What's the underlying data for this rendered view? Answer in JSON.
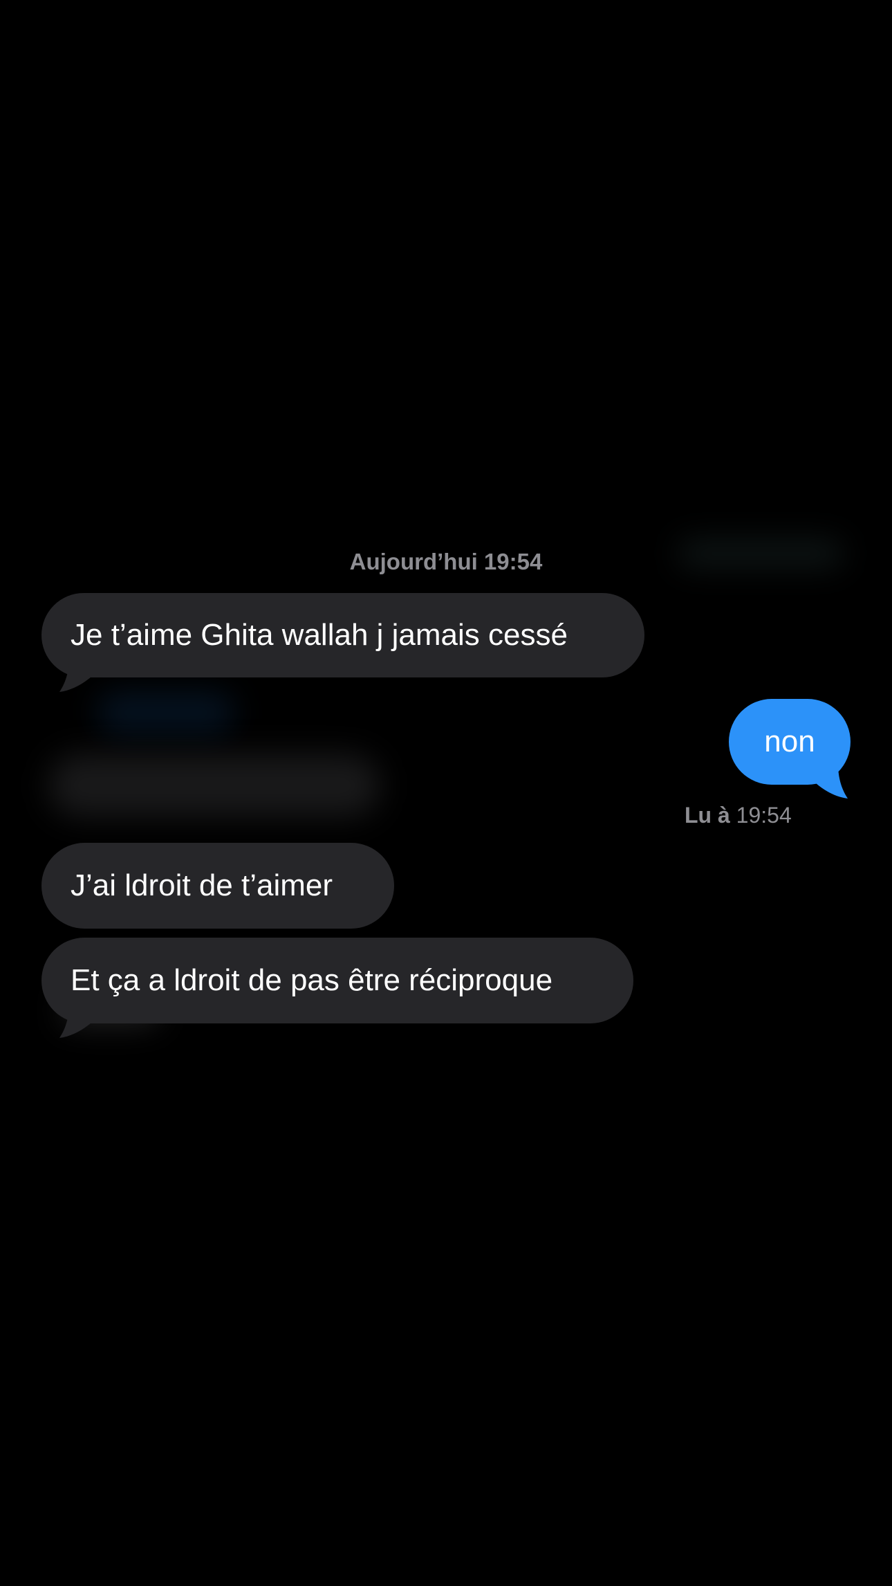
{
  "conversation": {
    "timestamp": "Aujourd’hui 19:54",
    "messages": [
      {
        "direction": "incoming",
        "text": "Je t’aime Ghita wallah j jamais cessé"
      },
      {
        "direction": "outgoing",
        "text": "non"
      },
      {
        "direction": "incoming",
        "text": "J’ai ldroit de t’aimer"
      },
      {
        "direction": "incoming",
        "text": "Et ça a ldroit de pas être réciproque"
      }
    ],
    "read_receipt": {
      "label": "Lu à",
      "time": "19:54"
    }
  },
  "colors": {
    "background": "#000000",
    "incoming_bubble": "#262629",
    "outgoing_bubble": "#2c92f9",
    "meta_text": "#8e8e93",
    "message_text": "#ffffff"
  }
}
